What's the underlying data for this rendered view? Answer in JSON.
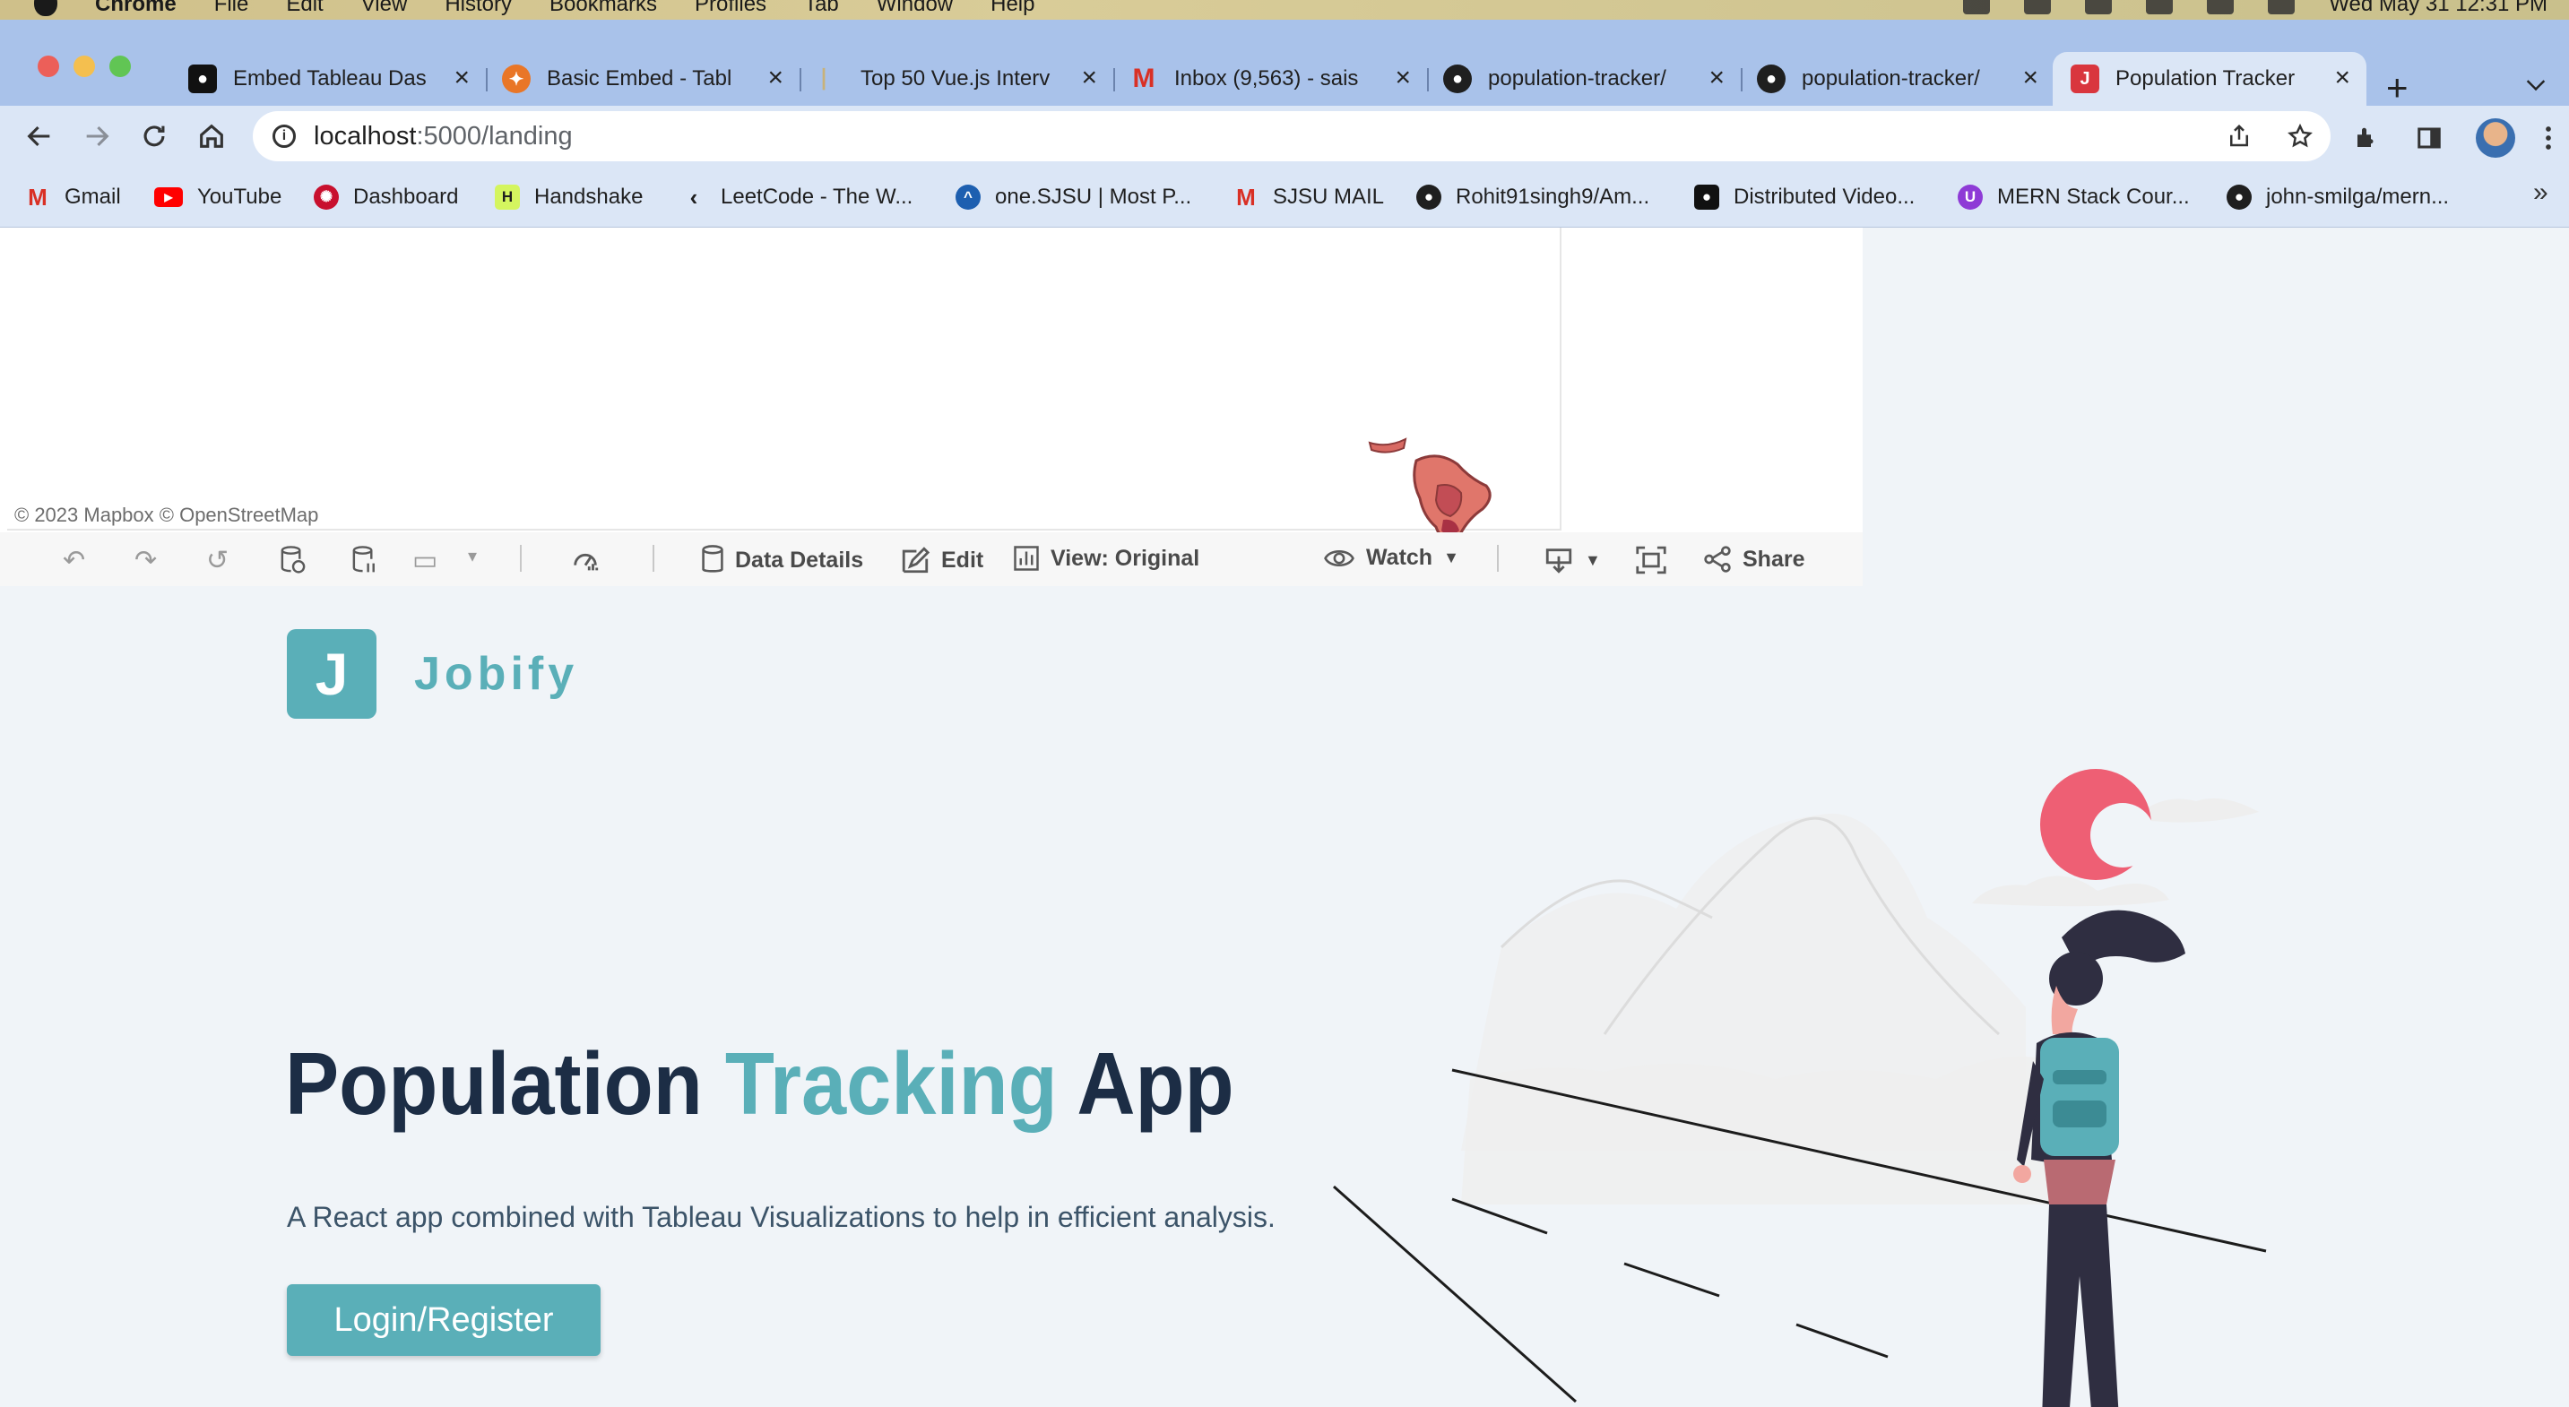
{
  "menubar": {
    "app": "Chrome",
    "menus": [
      "File",
      "Edit",
      "View",
      "History",
      "Bookmarks",
      "Profiles",
      "Tab",
      "Window",
      "Help"
    ],
    "clock": "Wed May 31  12:31 PM"
  },
  "tabs": [
    {
      "label": "Embed Tableau Das",
      "icon": "medium-icon"
    },
    {
      "label": "Basic Embed - Tabl",
      "icon": "tableau-icon"
    },
    {
      "label": "Top 50 Vue.js Interv",
      "icon": "page-icon"
    },
    {
      "label": "Inbox (9,563) - sais",
      "icon": "gmail-icon"
    },
    {
      "label": "population-tracker/",
      "icon": "github-icon"
    },
    {
      "label": "population-tracker/",
      "icon": "github-icon"
    },
    {
      "label": "Population Tracker",
      "icon": "jobify-icon",
      "active": true
    }
  ],
  "address": {
    "host": "localhost",
    "path": ":5000/landing"
  },
  "bookmarks": [
    {
      "label": "Gmail"
    },
    {
      "label": "YouTube"
    },
    {
      "label": "Dashboard"
    },
    {
      "label": "Handshake"
    },
    {
      "label": "LeetCode - The W..."
    },
    {
      "label": "one.SJSU | Most P..."
    },
    {
      "label": "SJSU MAIL"
    },
    {
      "label": "Rohit91singh9/Am..."
    },
    {
      "label": "Distributed Video..."
    },
    {
      "label": "MERN Stack Cour..."
    },
    {
      "label": "john-smilga/mern..."
    }
  ],
  "tableau": {
    "attribution": "© 2023 Mapbox  © OpenStreetMap",
    "toolbar": {
      "data_details": "Data Details",
      "edit": "Edit",
      "view": "View: Original",
      "watch": "Watch",
      "share": "Share"
    }
  },
  "landing": {
    "logo_letter": "J",
    "logo_name": "Jobify",
    "title_part1": "Population",
    "title_accent": "Tracking",
    "title_part2": "App",
    "subtitle": "A React app combined with Tableau Visualizations to help in efficient analysis.",
    "cta": "Login/Register"
  },
  "colors": {
    "accent": "#5aafb8",
    "heading": "#1c2d45",
    "tabstrip": "#a9c2ea",
    "toolbar": "#dbe6f6"
  }
}
